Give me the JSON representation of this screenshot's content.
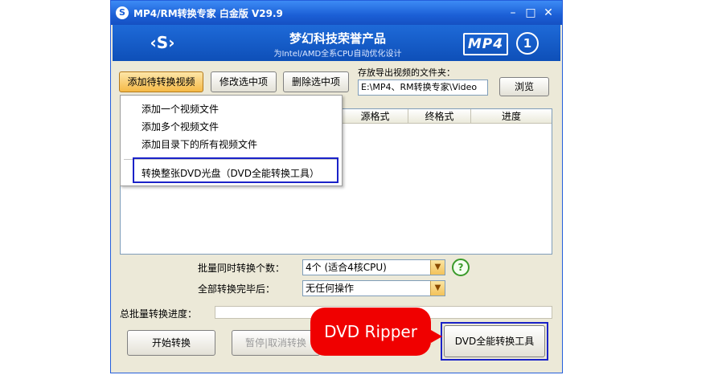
{
  "window": {
    "title": "MP4/RM转换专家 白金版 V29.9",
    "app_icon": "S",
    "controls": {
      "minimize": "–",
      "maximize": "□",
      "close": "✕"
    }
  },
  "banner": {
    "logo_text": "‹S›",
    "company": "梦幻科技荣誉产品",
    "subtitle": "为Intel/AMD全系CPU自动优化设计",
    "badge": "MP4",
    "badge_number": "1"
  },
  "toolbar": {
    "add_label": "添加待转换视频",
    "edit_label": "修改选中项",
    "delete_label": "删除选中项"
  },
  "output": {
    "label": "存放导出视频的文件夹：",
    "path": "E:\\MP4、RM转换专家\\Video",
    "browse_label": "浏览"
  },
  "table": {
    "columns": [
      "",
      "源格式",
      "终格式",
      "进度"
    ]
  },
  "add_menu": {
    "items": [
      "添加一个视频文件",
      "添加多个视频文件",
      "添加目录下的所有视频文件"
    ],
    "dvd_item": "转换整张DVD光盘（DVD全能转换工具）"
  },
  "options": {
    "concurrent_label": "批量同时转换个数：",
    "concurrent_value": "4个 (适合4核CPU)",
    "after_label": "全部转换完毕后：",
    "after_value": "无任何操作",
    "help_icon": "?"
  },
  "progress": {
    "label": "总批量转换进度：",
    "value_fraction": 0.0
  },
  "bottom": {
    "start_label": "开始转换",
    "pause_label": "暂停|取消转换",
    "dvd_tool_label": "DVD全能转换工具"
  },
  "callout": {
    "text": "DVD Ripper",
    "color": "#f00000"
  },
  "colors": {
    "highlight_border": "#1a22c8",
    "titlebar": "#1b5fd6"
  }
}
